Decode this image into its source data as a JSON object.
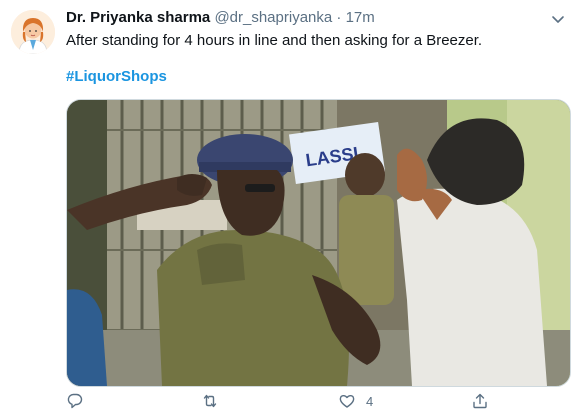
{
  "tweet": {
    "display_name": "Dr. Priyanka sharma",
    "handle": "@dr_shapriyanka",
    "separator": "·",
    "time": "17m",
    "text": "After standing for 4 hours in line and then asking for a Breezer.",
    "hashtag": "#LiquorShops",
    "image_sign_text": "LASSI"
  },
  "actions": {
    "reply_icon": "reply-icon",
    "retweet_icon": "retweet-icon",
    "like_icon": "like-icon",
    "like_count": "4",
    "share_icon": "share-icon"
  },
  "colors": {
    "link": "#1b95e0",
    "secondary_text": "#5b7083",
    "primary_text": "#0f1419"
  }
}
